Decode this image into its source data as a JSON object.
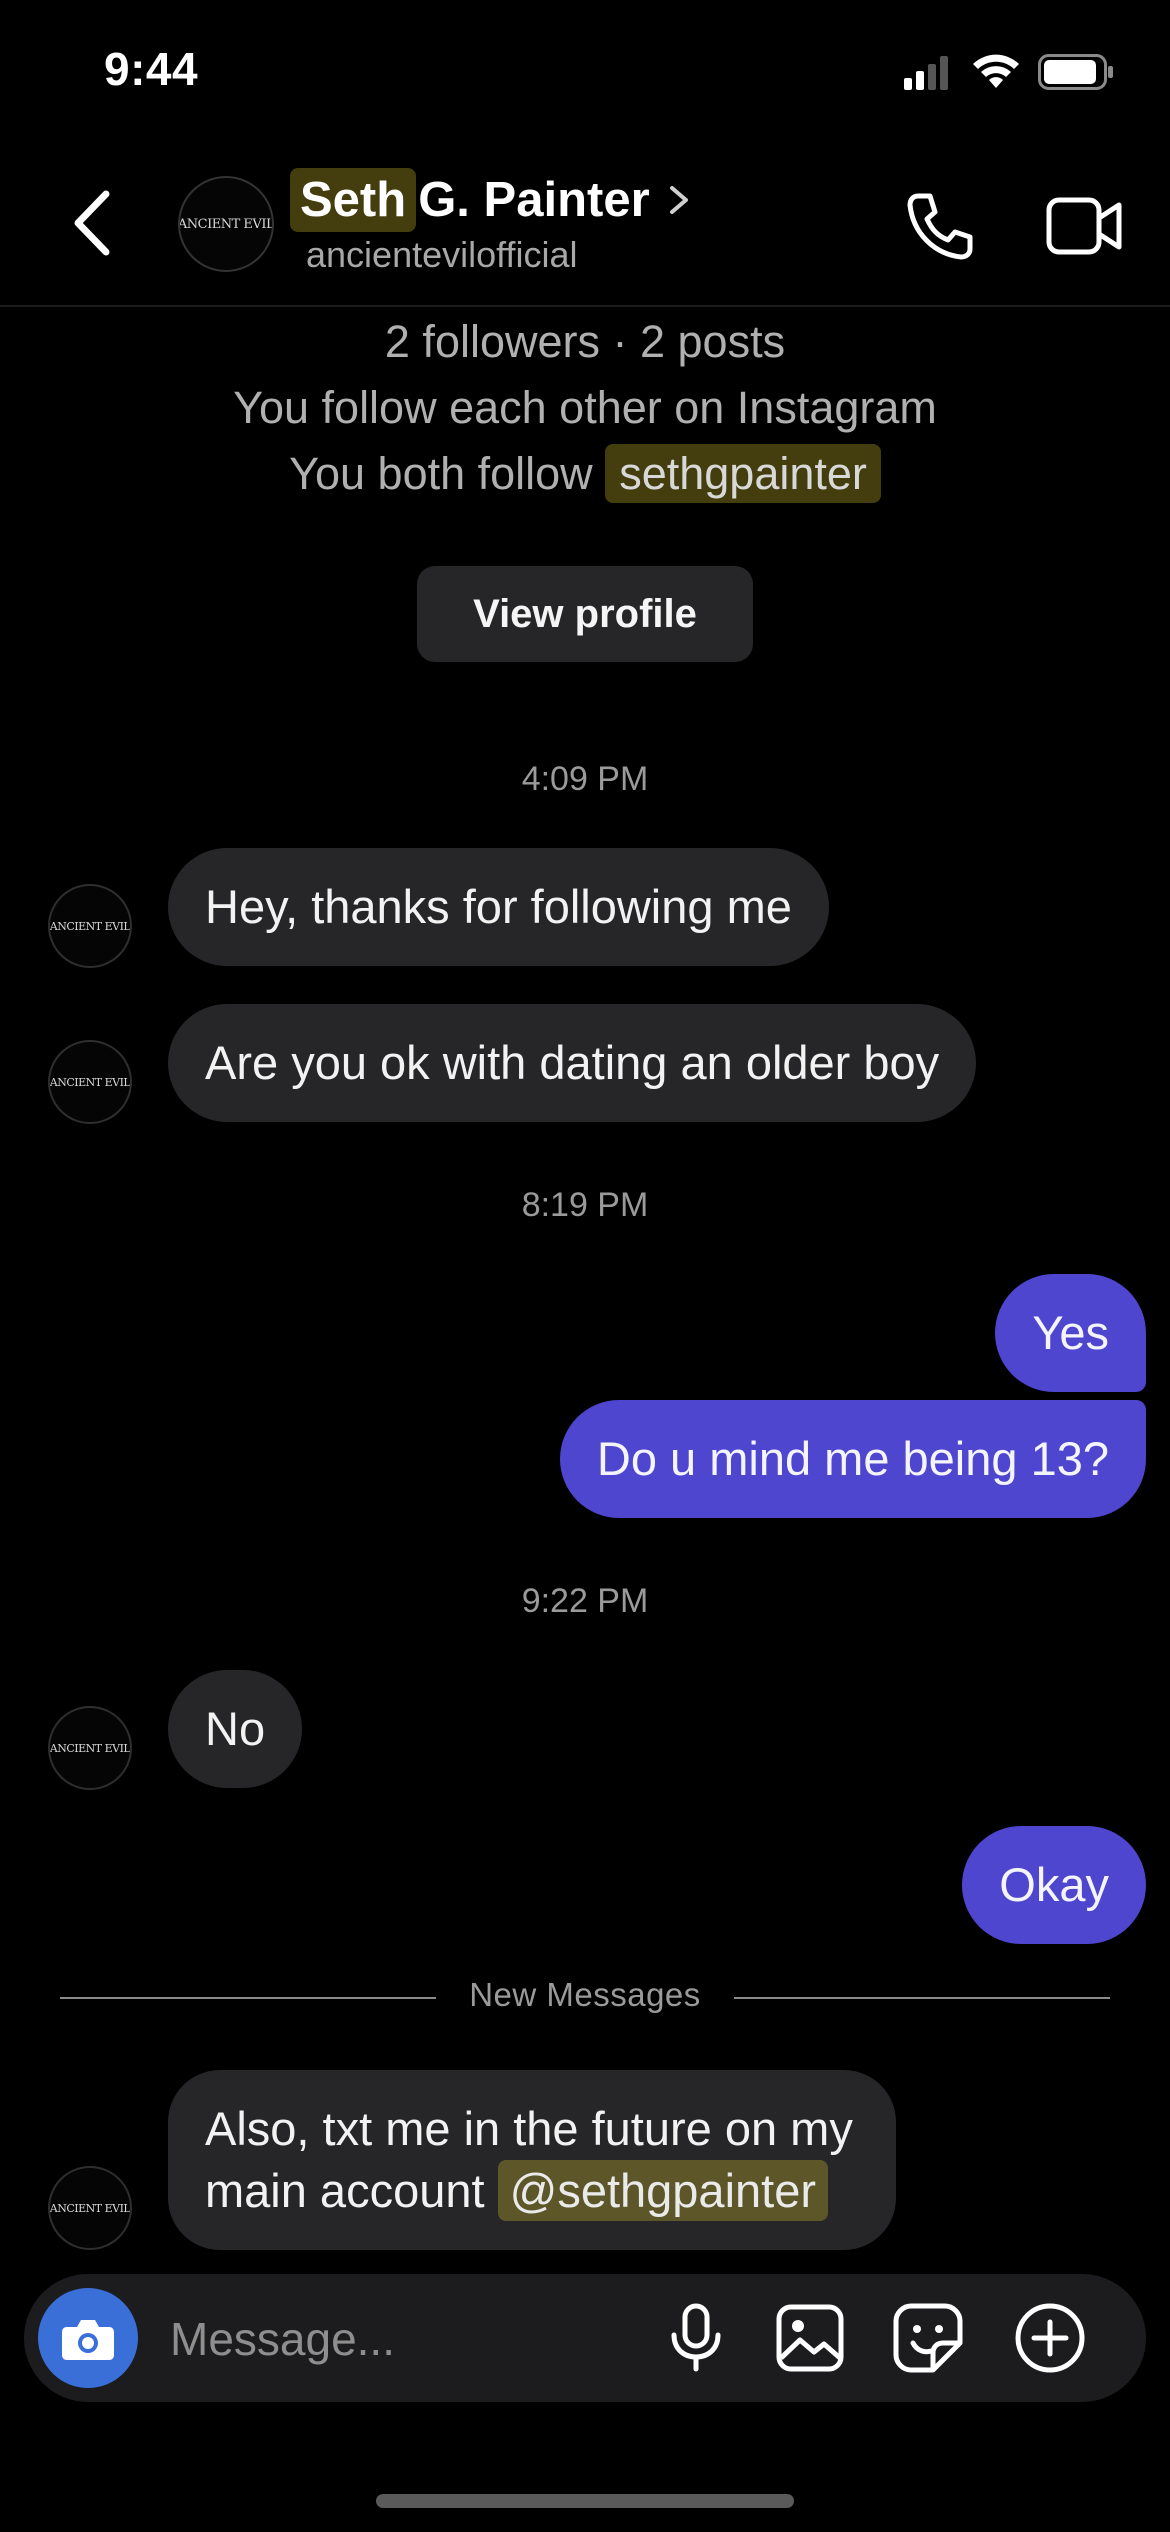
{
  "status_bar": {
    "time": "9:44"
  },
  "header": {
    "name_highlight": "Seth",
    "name_rest": "G. Painter",
    "username": "ancientevilofficial",
    "avatar_text": "ANCIENT EVIL"
  },
  "profile_info": {
    "stats": "2 followers · 2 posts",
    "mutual": "You follow each other on Instagram",
    "both_follow_prefix": "You both follow",
    "both_follow_account": "sethgpainter",
    "view_profile_label": "View profile"
  },
  "messages": {
    "stamp1": "4:09 PM",
    "m1": "Hey, thanks for following me",
    "m2": "Are you ok with dating an older boy",
    "stamp2": "8:19 PM",
    "m3": "Yes",
    "m4": "Do u mind me being 13?",
    "stamp3": "9:22 PM",
    "m5": "No",
    "m6": "Okay",
    "new_messages_label": "New Messages",
    "m7_text": "Also, txt me in the future on my main account",
    "m7_mention": "@sethgpainter"
  },
  "composer": {
    "placeholder": "Message..."
  },
  "colors": {
    "outgoing_bubble": "#4e46cf",
    "incoming_bubble": "#262628",
    "highlight": "#5a5317",
    "camera_button": "#3b6fd8"
  },
  "icons": [
    "chevron-left-icon",
    "chevron-right-icon",
    "phone-icon",
    "video-camera-icon",
    "camera-icon",
    "microphone-icon",
    "image-icon",
    "sticker-icon",
    "plus-circle-icon",
    "signal-icon",
    "wifi-icon",
    "battery-icon"
  ]
}
